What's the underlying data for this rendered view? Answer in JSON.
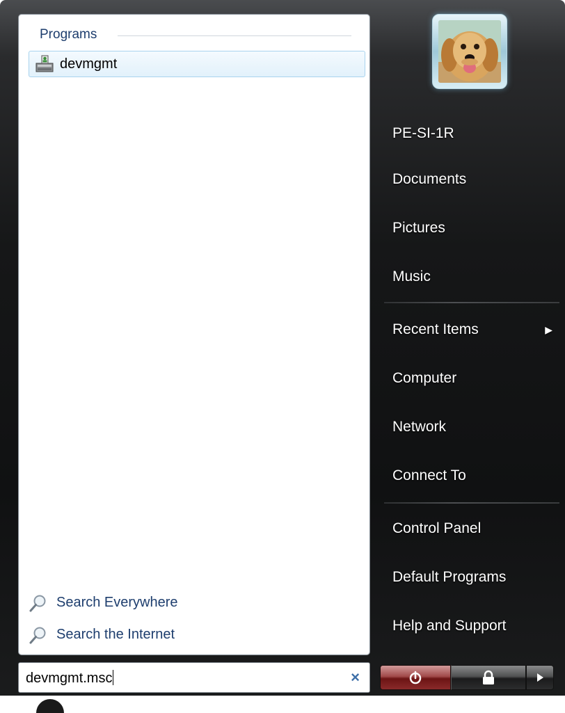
{
  "left_panel": {
    "programs_header": "Programs",
    "results": [
      {
        "label": "devmgmt",
        "icon": "device-manager-icon"
      }
    ],
    "search_links": [
      {
        "label": "Search Everywhere",
        "icon": "search-icon"
      },
      {
        "label": "Search the Internet",
        "icon": "search-icon"
      }
    ]
  },
  "search_box": {
    "value": "devmgmt.msc",
    "clear_icon": "×"
  },
  "user": {
    "avatar": "dog-avatar"
  },
  "right_menu": {
    "items": [
      {
        "label": "PE-SI-1R"
      },
      {
        "label": "Documents"
      },
      {
        "label": "Pictures"
      },
      {
        "label": "Music"
      },
      {
        "label": "Recent Items",
        "submenu": true
      },
      {
        "label": "Computer"
      },
      {
        "label": "Network"
      },
      {
        "label": "Connect To"
      },
      {
        "label": "Control Panel"
      },
      {
        "label": "Default Programs"
      },
      {
        "label": "Help and Support"
      }
    ]
  },
  "power_bar": {
    "power_icon": "power-icon",
    "lock_icon": "lock-icon",
    "arrow_icon": "right-arrow-icon"
  },
  "colors": {
    "accent_text": "#1e3e6e",
    "power_button": "#8a2a2a",
    "menu_background": "#161718"
  }
}
